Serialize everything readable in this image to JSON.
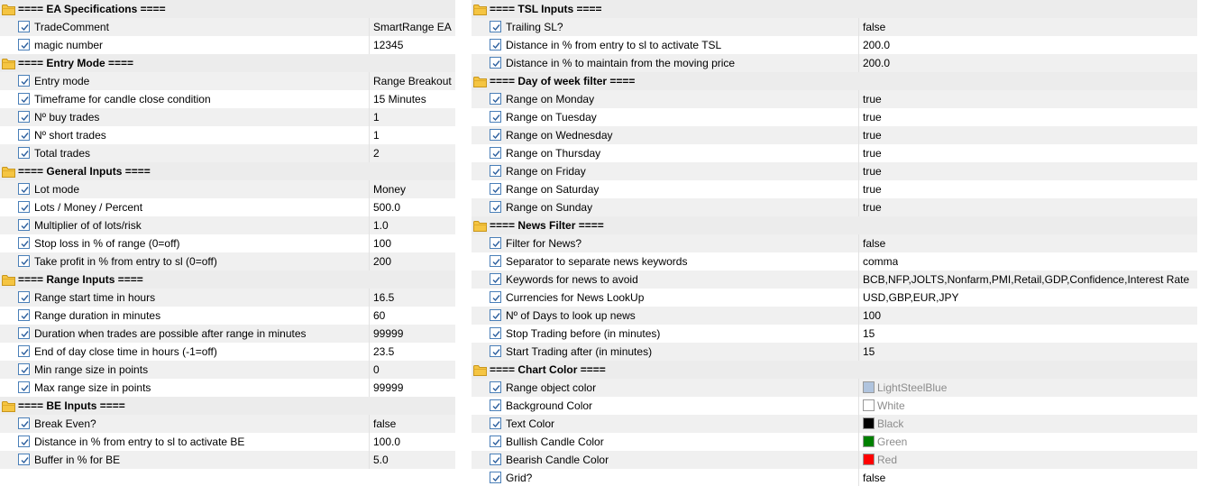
{
  "left": [
    {
      "type": "header",
      "name": "==== EA Specifications ===="
    },
    {
      "type": "param",
      "name": "TradeComment",
      "value": "SmartRange EA"
    },
    {
      "type": "param",
      "name": "magic number",
      "value": "12345"
    },
    {
      "type": "header",
      "name": "==== Entry Mode ===="
    },
    {
      "type": "param",
      "name": "Entry mode",
      "value": "Range Breakout"
    },
    {
      "type": "param",
      "name": "Timeframe for candle close condition",
      "value": "15 Minutes"
    },
    {
      "type": "param",
      "name": "Nº buy trades",
      "value": "1"
    },
    {
      "type": "param",
      "name": "Nº short trades",
      "value": "1"
    },
    {
      "type": "param",
      "name": "Total trades",
      "value": "2"
    },
    {
      "type": "header",
      "name": "==== General Inputs ===="
    },
    {
      "type": "param",
      "name": "Lot mode",
      "value": "Money"
    },
    {
      "type": "param",
      "name": "Lots / Money / Percent",
      "value": "500.0"
    },
    {
      "type": "param",
      "name": "Multiplier of of lots/risk",
      "value": "1.0"
    },
    {
      "type": "param",
      "name": "Stop loss in % of range (0=off)",
      "value": "100"
    },
    {
      "type": "param",
      "name": "Take profit in % from entry to sl (0=off)",
      "value": "200"
    },
    {
      "type": "header",
      "name": "==== Range Inputs ===="
    },
    {
      "type": "param",
      "name": "Range start time in hours",
      "value": "16.5"
    },
    {
      "type": "param",
      "name": "Range duration in minutes",
      "value": "60"
    },
    {
      "type": "param",
      "name": "Duration when trades are possible after range in minutes",
      "value": "99999"
    },
    {
      "type": "param",
      "name": "End of day close time in hours (-1=off)",
      "value": "23.5"
    },
    {
      "type": "param",
      "name": "Min range size in points",
      "value": "0"
    },
    {
      "type": "param",
      "name": "Max range size in points",
      "value": "99999"
    },
    {
      "type": "header",
      "name": "==== BE Inputs ===="
    },
    {
      "type": "param",
      "name": "Break Even?",
      "value": "false"
    },
    {
      "type": "param",
      "name": "Distance in % from entry to sl to activate BE",
      "value": "100.0"
    },
    {
      "type": "param",
      "name": "Buffer in % for BE",
      "value": "5.0"
    }
  ],
  "right": [
    {
      "type": "header",
      "name": "==== TSL Inputs ===="
    },
    {
      "type": "param",
      "name": "Trailing SL?",
      "value": "false"
    },
    {
      "type": "param",
      "name": "Distance in % from entry to sl to activate TSL",
      "value": "200.0"
    },
    {
      "type": "param",
      "name": "Distance in % to maintain from the moving price",
      "value": "200.0"
    },
    {
      "type": "header",
      "name": "==== Day of week filter ===="
    },
    {
      "type": "param",
      "name": "Range on Monday",
      "value": "true"
    },
    {
      "type": "param",
      "name": "Range on Tuesday",
      "value": "true"
    },
    {
      "type": "param",
      "name": "Range on Wednesday",
      "value": "true"
    },
    {
      "type": "param",
      "name": "Range on Thursday",
      "value": "true"
    },
    {
      "type": "param",
      "name": "Range on Friday",
      "value": "true"
    },
    {
      "type": "param",
      "name": "Range on Saturday",
      "value": "true"
    },
    {
      "type": "param",
      "name": "Range on Sunday",
      "value": "true"
    },
    {
      "type": "header",
      "name": "==== News Filter ===="
    },
    {
      "type": "param",
      "name": "Filter for News?",
      "value": "false"
    },
    {
      "type": "param",
      "name": "Separator to separate news keywords",
      "value": "comma"
    },
    {
      "type": "param",
      "name": "Keywords for news to avoid",
      "value": "BCB,NFP,JOLTS,Nonfarm,PMI,Retail,GDP,Confidence,Interest Rate"
    },
    {
      "type": "param",
      "name": "Currencies for News LookUp",
      "value": "USD,GBP,EUR,JPY"
    },
    {
      "type": "param",
      "name": "Nº of Days to look up news",
      "value": "100"
    },
    {
      "type": "param",
      "name": "Stop Trading before (in minutes)",
      "value": "15"
    },
    {
      "type": "param",
      "name": "Start Trading after (in minutes)",
      "value": "15"
    },
    {
      "type": "header",
      "name": "==== Chart Color ===="
    },
    {
      "type": "param",
      "name": "Range object color",
      "value": "LightSteelBlue",
      "swatch": "#b0c4de"
    },
    {
      "type": "param",
      "name": "Background Color",
      "value": "White",
      "swatch": "#ffffff"
    },
    {
      "type": "param",
      "name": "Text Color",
      "value": "Black",
      "swatch": "#000000"
    },
    {
      "type": "param",
      "name": "Bullish Candle Color",
      "value": "Green",
      "swatch": "#008000"
    },
    {
      "type": "param",
      "name": "Bearish Candle Color",
      "value": "Red",
      "swatch": "#ff0000"
    },
    {
      "type": "param",
      "name": "Grid?",
      "value": "false"
    }
  ],
  "icons": {
    "header": "folder-icon",
    "param": "checkbox-checked-icon"
  },
  "colors": {
    "row_alt": "#f0f0f0",
    "header_bg": "#ececec",
    "folder": "#f5c542",
    "checkbox_border": "#4a7fb8"
  }
}
